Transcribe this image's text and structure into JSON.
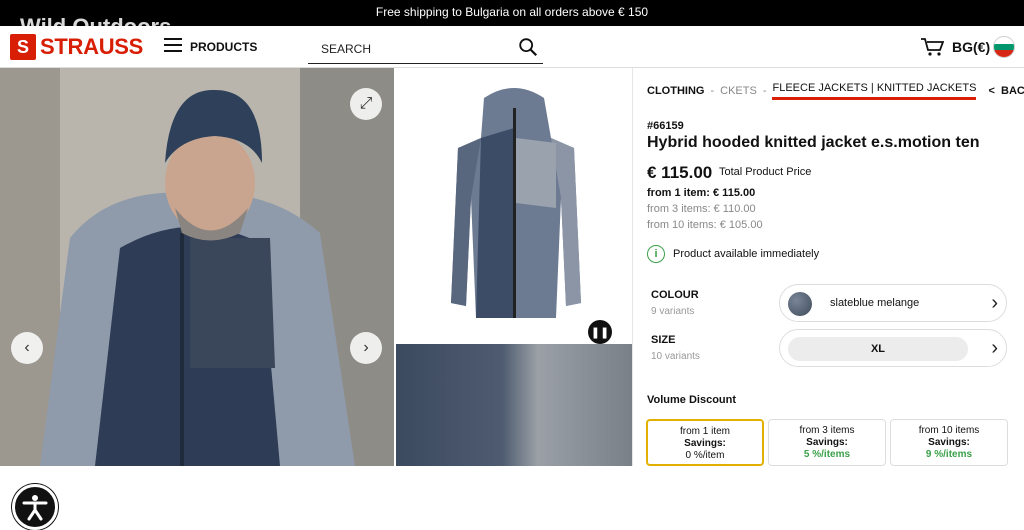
{
  "promo_bar": "Free shipping to Bulgaria on all orders above € 150",
  "watermark": "Wild Outdoors",
  "header": {
    "brand": "STRAUSS",
    "products_label": "PRODUCTS",
    "search_placeholder": "SEARCH",
    "language": "BG(€)"
  },
  "breadcrumb": {
    "items": [
      "CLOTHING",
      "-",
      "CKETS",
      "-",
      "FLEECE JACKETS | KNITTED JACKETS"
    ],
    "back_label": "BACK",
    "back_arrow": "<"
  },
  "product": {
    "sku": "#66159",
    "title": "Hybrid hooded knitted jacket e.s.motion ten",
    "price": "€ 115.00",
    "price_note": "Total Product Price",
    "tiers": [
      "from 1 item: € 115.00",
      "from 3 items: € 110.00",
      "from 10 items: € 105.00"
    ],
    "availability": "Product available immediately",
    "colour": {
      "label": "COLOUR",
      "sub": "9 variants",
      "value": "slateblue melange"
    },
    "size": {
      "label": "SIZE",
      "sub": "10 variants",
      "value": "XL"
    }
  },
  "volume_discount": {
    "label": "Volume Discount",
    "cards": [
      {
        "title": "from 1 item",
        "savings_label": "Savings:",
        "savings": "0 %/item"
      },
      {
        "title": "from 3 items",
        "savings_label": "Savings:",
        "savings": "5 %/items"
      },
      {
        "title": "from 10 items",
        "savings_label": "Savings:",
        "savings": "9 %/items"
      }
    ]
  },
  "colors": {
    "brand_red": "#d81e05",
    "selected_border": "#e2b100",
    "savings_green": "#3aa04a"
  }
}
